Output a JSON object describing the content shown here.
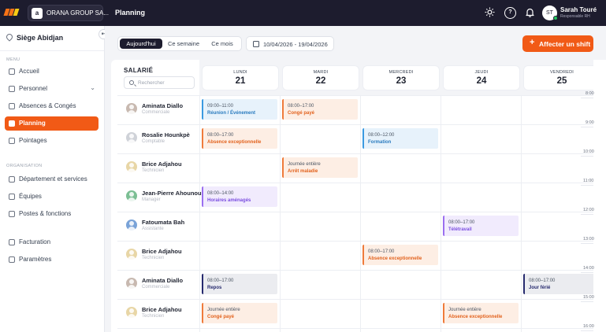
{
  "topbar": {
    "logo_colors": [
      "#f97316",
      "#f97316",
      "#facc15"
    ],
    "company_initial": "a",
    "company_name": "ORANA GROUP SA...",
    "page_title": "Planning",
    "icons": [
      "sun-icon",
      "help-icon",
      "bell-icon"
    ],
    "help_glyph": "?",
    "user": {
      "initials": "ST",
      "name": "Sarah Touré",
      "role": "Responsable RH",
      "status_color": "#22c55e"
    }
  },
  "sidebar": {
    "site": "Siège Abidjan",
    "menu_title": "MENU",
    "collapse_glyph": "⇤",
    "menu": [
      {
        "label": "Accueil",
        "icon": "home-icon"
      },
      {
        "label": "Personnel",
        "icon": "users-icon",
        "chevron": "⌄"
      },
      {
        "label": "Absences & Congés",
        "icon": "moon-icon"
      },
      {
        "label": "Planning",
        "icon": "calendar-icon",
        "active": true
      },
      {
        "label": "Pointages",
        "icon": "clock-icon"
      }
    ],
    "org_title": "ORGANISATION",
    "organisation": [
      {
        "label": "Département et services",
        "icon": "building-icon"
      },
      {
        "label": "Équipes",
        "icon": "team-icon"
      },
      {
        "label": "Postes & fonctions",
        "icon": "briefcase-icon"
      }
    ],
    "bottom": [
      {
        "label": "Facturation",
        "icon": "card-icon"
      },
      {
        "label": "Paramètres",
        "icon": "gear-icon"
      }
    ]
  },
  "toolbar": {
    "views": [
      "Aujourd'hui",
      "Ce semaine",
      "Ce mois"
    ],
    "active_view": "Aujourd'hui",
    "date_range": "10/04/2026 - 19/04/2026",
    "assign_plus": "+",
    "assign_label": "Affecter un shift",
    "accent": "#f15a16"
  },
  "grid": {
    "employee_header": "SALARIÉ",
    "search_placeholder": "Rechercher",
    "days": [
      {
        "name": "LUNDI",
        "num": "21"
      },
      {
        "name": "MARDI",
        "num": "22"
      },
      {
        "name": "MERCREDI",
        "num": "23"
      },
      {
        "name": "JEUDI",
        "num": "24"
      },
      {
        "name": "VENDREDI",
        "num": "25"
      }
    ],
    "hours": [
      "8:00",
      "9:00",
      "10:00",
      "11:00",
      "12:00",
      "13:00",
      "14:00",
      "15:00",
      "16:00"
    ],
    "employees": [
      {
        "name": "Aminata Diallo",
        "role": "Commerciale",
        "avatar_color": "#c8b9b0"
      },
      {
        "name": "Rosalie Hounkpè",
        "role": "Comptable",
        "avatar_color": "#cfd2d8"
      },
      {
        "name": "Brice Adjahou",
        "role": "Technicien",
        "avatar_color": "#e8d6a6"
      },
      {
        "name": "Jean-Pierre Ahounou",
        "role": "Manager",
        "avatar_color": "#7cbf94"
      },
      {
        "name": "Fatoumata Bah",
        "role": "Assistante",
        "avatar_color": "#7aa3d8"
      },
      {
        "name": "Brice Adjahou",
        "role": "Technicien",
        "avatar_color": "#e8d6a6"
      },
      {
        "name": "Aminata Diallo",
        "role": "Commerciale",
        "avatar_color": "#c8b9b0"
      },
      {
        "name": "Brice Adjahou",
        "role": "Technicien",
        "avatar_color": "#e8d6a6"
      }
    ],
    "shifts": [
      {
        "row": 0,
        "day": 0,
        "time": "09:00–11:00",
        "type": "Réunion / Événement",
        "kind": "event"
      },
      {
        "row": 0,
        "day": 1,
        "time": "08:00–17:00",
        "type": "Congé payé",
        "kind": "leave"
      },
      {
        "row": 1,
        "day": 0,
        "time": "08:00–17:00",
        "type": "Absence exceptionnelle",
        "kind": "leave"
      },
      {
        "row": 1,
        "day": 2,
        "time": "08:00–12:00",
        "type": "Formation",
        "kind": "event"
      },
      {
        "row": 2,
        "day": 1,
        "time": "Journée entière",
        "type": "Arrêt maladie",
        "kind": "leave"
      },
      {
        "row": 3,
        "day": 0,
        "time": "08:00–14:00",
        "type": "Horaires aménagés",
        "kind": "special"
      },
      {
        "row": 4,
        "day": 3,
        "time": "08:00–17:00",
        "type": "Télétravail",
        "kind": "special"
      },
      {
        "row": 5,
        "day": 2,
        "time": "08:00–17:00",
        "type": "Absence exceptionnelle",
        "kind": "leave"
      },
      {
        "row": 6,
        "day": 0,
        "time": "08:00–17:00",
        "type": "Repos",
        "kind": "rest"
      },
      {
        "row": 6,
        "day": 4,
        "time": "08:00–17:00",
        "type": "Jour férié",
        "kind": "rest"
      },
      {
        "row": 7,
        "day": 0,
        "time": "Journée entière",
        "type": "Congé payé",
        "kind": "leave"
      },
      {
        "row": 7,
        "day": 3,
        "time": "Journée entière",
        "type": "Absence exceptionnelle",
        "kind": "leave"
      }
    ],
    "shift_styles": {
      "event": {
        "bg": "#e7f2fb",
        "border": "#3b9ae1",
        "text": "#2a7bbf"
      },
      "leave": {
        "bg": "#fdeee4",
        "border": "#ef7b3b",
        "text": "#e2621d"
      },
      "special": {
        "bg": "#f1ebfd",
        "border": "#9b6ff0",
        "text": "#7b4ee0"
      },
      "rest": {
        "bg": "#ebecf0",
        "border": "#262a6e",
        "text": "#262a6e"
      }
    }
  }
}
